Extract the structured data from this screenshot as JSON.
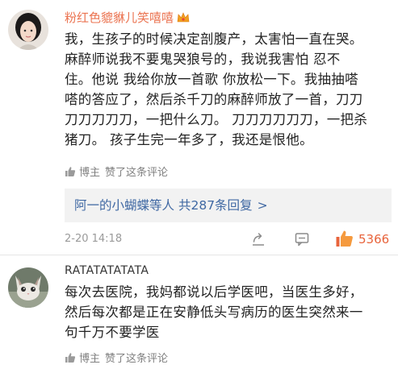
{
  "comments": [
    {
      "username": "粉红色貔貅儿笑嘻嘻",
      "lines": [
        "我，生孩子的时候决定剖腹产，太害怕一直在哭。",
        "麻醉师说我不要鬼哭狼号的，我说我害怕 忍不",
        "住。他说 我给你放一首歌 你放松一下。我抽抽嗒",
        "嗒的答应了，然后杀千刀的麻醉师放了一首，刀刀",
        "刀刀刀刀刀，一把什么刀。 刀刀刀刀刀刀，一把杀",
        "猪刀。 孩子生完一年多了，我还是恨他。"
      ],
      "liked_by_author": {
        "who": "博主",
        "text": "赞了这条评论"
      },
      "replies": {
        "from": "阿一的小蝴蝶",
        "suffix": "等人",
        "count_text": "共287条回复",
        "chevron": ">"
      },
      "timestamp": "2-20 14:18",
      "like_count": "5366"
    },
    {
      "username": "RATATATATATA",
      "lines": [
        "每次去医院，我妈都说以后学医吧，当医生多好，",
        "然后每次都是正在安静低头写病历的医生突然来一",
        "句千万不要学医"
      ],
      "liked_by_author": {
        "who": "博主",
        "text": "赞了这条评论"
      }
    }
  ],
  "colors": {
    "username_vip": "#eb7350",
    "link": "#3f68a3",
    "like_active": "#e8643c",
    "meta": "#808080"
  },
  "icons": [
    "crown-icon",
    "thumb-icon",
    "share-icon",
    "comment-icon",
    "like-icon"
  ]
}
